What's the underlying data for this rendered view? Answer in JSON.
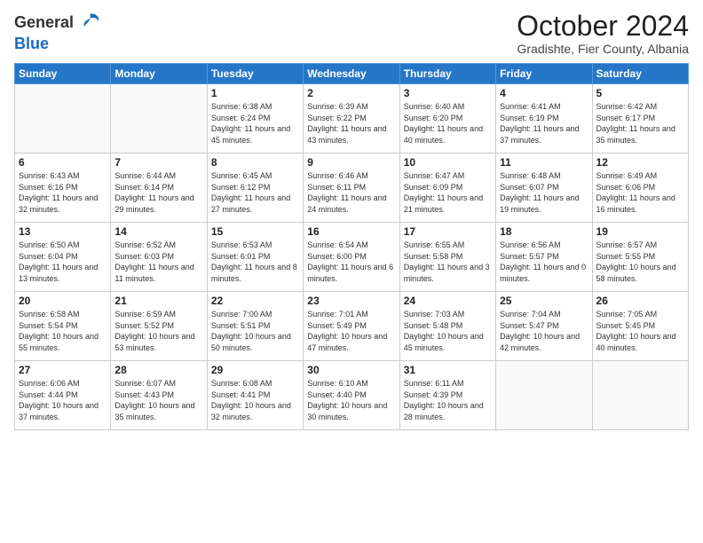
{
  "header": {
    "logo_general": "General",
    "logo_blue": "Blue",
    "month": "October 2024",
    "location": "Gradishte, Fier County, Albania"
  },
  "days_of_week": [
    "Sunday",
    "Monday",
    "Tuesday",
    "Wednesday",
    "Thursday",
    "Friday",
    "Saturday"
  ],
  "weeks": [
    [
      {
        "day": "",
        "info": ""
      },
      {
        "day": "",
        "info": ""
      },
      {
        "day": "1",
        "sunrise": "6:38 AM",
        "sunset": "6:24 PM",
        "daylight": "11 hours and 45 minutes."
      },
      {
        "day": "2",
        "sunrise": "6:39 AM",
        "sunset": "6:22 PM",
        "daylight": "11 hours and 43 minutes."
      },
      {
        "day": "3",
        "sunrise": "6:40 AM",
        "sunset": "6:20 PM",
        "daylight": "11 hours and 40 minutes."
      },
      {
        "day": "4",
        "sunrise": "6:41 AM",
        "sunset": "6:19 PM",
        "daylight": "11 hours and 37 minutes."
      },
      {
        "day": "5",
        "sunrise": "6:42 AM",
        "sunset": "6:17 PM",
        "daylight": "11 hours and 35 minutes."
      }
    ],
    [
      {
        "day": "6",
        "sunrise": "6:43 AM",
        "sunset": "6:16 PM",
        "daylight": "11 hours and 32 minutes."
      },
      {
        "day": "7",
        "sunrise": "6:44 AM",
        "sunset": "6:14 PM",
        "daylight": "11 hours and 29 minutes."
      },
      {
        "day": "8",
        "sunrise": "6:45 AM",
        "sunset": "6:12 PM",
        "daylight": "11 hours and 27 minutes."
      },
      {
        "day": "9",
        "sunrise": "6:46 AM",
        "sunset": "6:11 PM",
        "daylight": "11 hours and 24 minutes."
      },
      {
        "day": "10",
        "sunrise": "6:47 AM",
        "sunset": "6:09 PM",
        "daylight": "11 hours and 21 minutes."
      },
      {
        "day": "11",
        "sunrise": "6:48 AM",
        "sunset": "6:07 PM",
        "daylight": "11 hours and 19 minutes."
      },
      {
        "day": "12",
        "sunrise": "6:49 AM",
        "sunset": "6:06 PM",
        "daylight": "11 hours and 16 minutes."
      }
    ],
    [
      {
        "day": "13",
        "sunrise": "6:50 AM",
        "sunset": "6:04 PM",
        "daylight": "11 hours and 13 minutes."
      },
      {
        "day": "14",
        "sunrise": "6:52 AM",
        "sunset": "6:03 PM",
        "daylight": "11 hours and 11 minutes."
      },
      {
        "day": "15",
        "sunrise": "6:53 AM",
        "sunset": "6:01 PM",
        "daylight": "11 hours and 8 minutes."
      },
      {
        "day": "16",
        "sunrise": "6:54 AM",
        "sunset": "6:00 PM",
        "daylight": "11 hours and 6 minutes."
      },
      {
        "day": "17",
        "sunrise": "6:55 AM",
        "sunset": "5:58 PM",
        "daylight": "11 hours and 3 minutes."
      },
      {
        "day": "18",
        "sunrise": "6:56 AM",
        "sunset": "5:57 PM",
        "daylight": "11 hours and 0 minutes."
      },
      {
        "day": "19",
        "sunrise": "6:57 AM",
        "sunset": "5:55 PM",
        "daylight": "10 hours and 58 minutes."
      }
    ],
    [
      {
        "day": "20",
        "sunrise": "6:58 AM",
        "sunset": "5:54 PM",
        "daylight": "10 hours and 55 minutes."
      },
      {
        "day": "21",
        "sunrise": "6:59 AM",
        "sunset": "5:52 PM",
        "daylight": "10 hours and 53 minutes."
      },
      {
        "day": "22",
        "sunrise": "7:00 AM",
        "sunset": "5:51 PM",
        "daylight": "10 hours and 50 minutes."
      },
      {
        "day": "23",
        "sunrise": "7:01 AM",
        "sunset": "5:49 PM",
        "daylight": "10 hours and 47 minutes."
      },
      {
        "day": "24",
        "sunrise": "7:03 AM",
        "sunset": "5:48 PM",
        "daylight": "10 hours and 45 minutes."
      },
      {
        "day": "25",
        "sunrise": "7:04 AM",
        "sunset": "5:47 PM",
        "daylight": "10 hours and 42 minutes."
      },
      {
        "day": "26",
        "sunrise": "7:05 AM",
        "sunset": "5:45 PM",
        "daylight": "10 hours and 40 minutes."
      }
    ],
    [
      {
        "day": "27",
        "sunrise": "6:06 AM",
        "sunset": "4:44 PM",
        "daylight": "10 hours and 37 minutes."
      },
      {
        "day": "28",
        "sunrise": "6:07 AM",
        "sunset": "4:43 PM",
        "daylight": "10 hours and 35 minutes."
      },
      {
        "day": "29",
        "sunrise": "6:08 AM",
        "sunset": "4:41 PM",
        "daylight": "10 hours and 32 minutes."
      },
      {
        "day": "30",
        "sunrise": "6:10 AM",
        "sunset": "4:40 PM",
        "daylight": "10 hours and 30 minutes."
      },
      {
        "day": "31",
        "sunrise": "6:11 AM",
        "sunset": "4:39 PM",
        "daylight": "10 hours and 28 minutes."
      },
      {
        "day": "",
        "info": ""
      },
      {
        "day": "",
        "info": ""
      }
    ]
  ]
}
